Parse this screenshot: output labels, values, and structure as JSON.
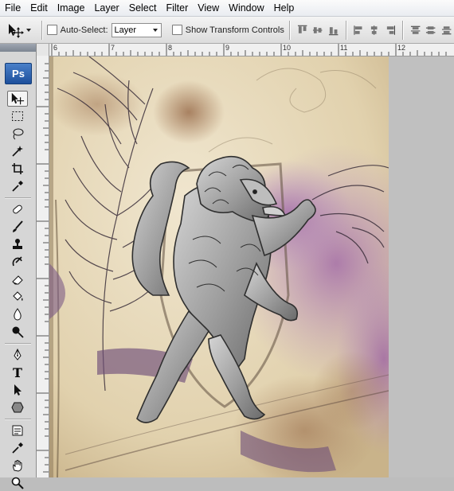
{
  "menu": [
    "File",
    "Edit",
    "Image",
    "Layer",
    "Select",
    "Filter",
    "View",
    "Window",
    "Help"
  ],
  "options": {
    "auto_select_label": "Auto-Select:",
    "auto_select_value": "Layer",
    "show_transform_label": "Show Transform Controls"
  },
  "ruler": {
    "ticks": [
      "6",
      "7",
      "8",
      "9",
      "10",
      "11",
      "12"
    ]
  },
  "tools": {
    "app_badge": "Ps",
    "items": [
      "move",
      "marquee",
      "lasso",
      "magic-wand",
      "crop",
      "eyedropper",
      "healing-brush",
      "brush",
      "clone-stamp",
      "history-brush",
      "eraser",
      "paint-bucket",
      "blur",
      "dodge",
      "pen",
      "type",
      "path-selection",
      "shape",
      "notes",
      "eyedropper-2",
      "hand",
      "zoom"
    ],
    "type_glyph": "T"
  },
  "canvas": {
    "description_colors": {
      "paper": "#e7dabd",
      "purple": "#8a5a9a",
      "lion": "#9a9a9a",
      "lion_dark": "#3a3a3a"
    }
  }
}
